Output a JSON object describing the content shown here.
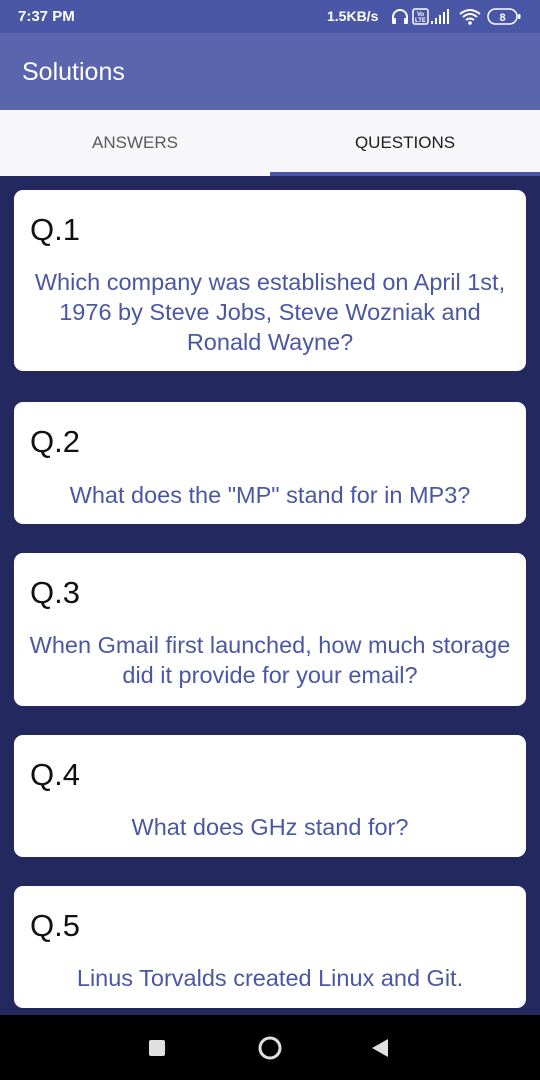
{
  "status_bar": {
    "time": "7:37 PM",
    "speed": "1.5KB/s",
    "battery": "8",
    "volte_label": "Vo LTE"
  },
  "app_bar": {
    "title": "Solutions"
  },
  "tabs": [
    {
      "label": "ANSWERS",
      "selected": false
    },
    {
      "label": "QUESTIONS",
      "selected": true
    }
  ],
  "questions": [
    {
      "number": "Q.1",
      "text": "Which company was established on April 1st, 1976 by Steve Jobs, Steve Wozniak and Ronald Wayne?"
    },
    {
      "number": "Q.2",
      "text": "What does the \"MP\" stand for in MP3?"
    },
    {
      "number": "Q.3",
      "text": "When Gmail first launched, how much storage did it provide for your email?"
    },
    {
      "number": "Q.4",
      "text": "What does GHz stand for?"
    },
    {
      "number": "Q.5",
      "text": "Linus Torvalds created Linux and Git."
    }
  ],
  "nav_bar": {
    "icons": [
      "recents-icon",
      "home-icon",
      "back-icon"
    ]
  },
  "colors": {
    "status_bar": "#4a56a6",
    "app_bar": "#5965ad",
    "background": "#23295e",
    "tab_bar": "#f7f7f9",
    "tab_indicator": "#4a56a6",
    "question_text": "#4a58a4"
  }
}
